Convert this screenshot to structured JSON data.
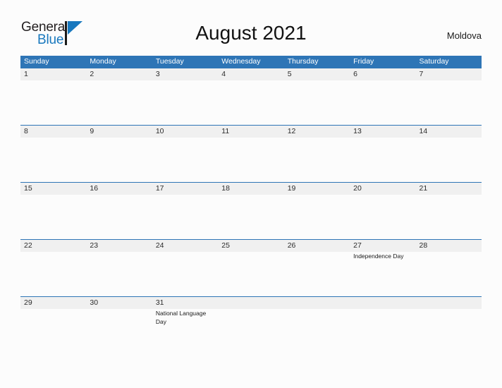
{
  "brand": {
    "word_one": "General",
    "word_two": "Blue",
    "mark_icon": "triangle-flag-icon",
    "color_dark": "#231f20",
    "color_blue": "#1878be"
  },
  "header": {
    "title": "August 2021",
    "region": "Moldova"
  },
  "theme": {
    "header_blue": "#2e75b6",
    "band_gray": "#f0f0f0",
    "page_background": "#fcfcfc",
    "rule_blue": "#2e75b6"
  },
  "calendar": {
    "weekdays": [
      "Sunday",
      "Monday",
      "Tuesday",
      "Wednesday",
      "Thursday",
      "Friday",
      "Saturday"
    ],
    "weeks": [
      [
        {
          "day": "1",
          "events": []
        },
        {
          "day": "2",
          "events": []
        },
        {
          "day": "3",
          "events": []
        },
        {
          "day": "4",
          "events": []
        },
        {
          "day": "5",
          "events": []
        },
        {
          "day": "6",
          "events": []
        },
        {
          "day": "7",
          "events": []
        }
      ],
      [
        {
          "day": "8",
          "events": []
        },
        {
          "day": "9",
          "events": []
        },
        {
          "day": "10",
          "events": []
        },
        {
          "day": "11",
          "events": []
        },
        {
          "day": "12",
          "events": []
        },
        {
          "day": "13",
          "events": []
        },
        {
          "day": "14",
          "events": []
        }
      ],
      [
        {
          "day": "15",
          "events": []
        },
        {
          "day": "16",
          "events": []
        },
        {
          "day": "17",
          "events": []
        },
        {
          "day": "18",
          "events": []
        },
        {
          "day": "19",
          "events": []
        },
        {
          "day": "20",
          "events": []
        },
        {
          "day": "21",
          "events": []
        }
      ],
      [
        {
          "day": "22",
          "events": []
        },
        {
          "day": "23",
          "events": []
        },
        {
          "day": "24",
          "events": []
        },
        {
          "day": "25",
          "events": []
        },
        {
          "day": "26",
          "events": []
        },
        {
          "day": "27",
          "events": [
            "Independence Day"
          ]
        },
        {
          "day": "28",
          "events": []
        }
      ],
      [
        {
          "day": "29",
          "events": []
        },
        {
          "day": "30",
          "events": []
        },
        {
          "day": "31",
          "events": [
            "National Language Day"
          ]
        },
        {
          "day": "",
          "events": []
        },
        {
          "day": "",
          "events": []
        },
        {
          "day": "",
          "events": []
        },
        {
          "day": "",
          "events": []
        }
      ]
    ]
  }
}
